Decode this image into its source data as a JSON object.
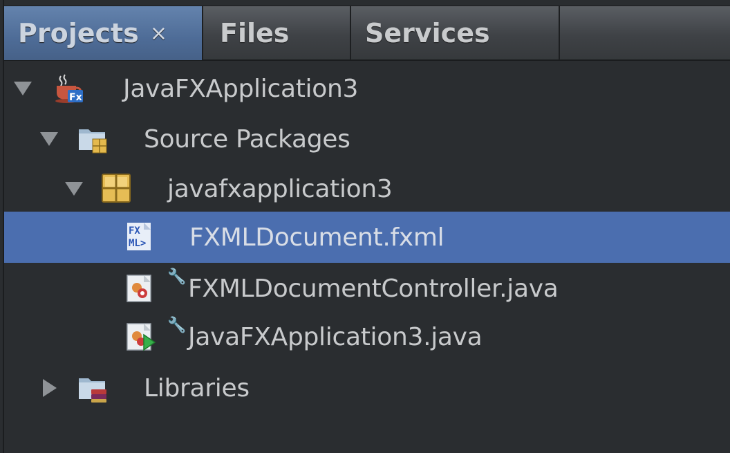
{
  "tabs": [
    {
      "label": "Projects",
      "active": true,
      "close": "×"
    },
    {
      "label": "Files",
      "active": false
    },
    {
      "label": "Services",
      "active": false
    }
  ],
  "tree": {
    "project": {
      "label": "JavaFXApplication3",
      "icon": "javafx-project-icon",
      "expanded": true
    },
    "source_packages": {
      "label": "Source Packages",
      "icon": "source-packages-icon",
      "expanded": true
    },
    "package": {
      "label": "javafxapplication3",
      "icon": "package-icon",
      "expanded": true
    },
    "files": [
      {
        "label": "FXMLDocument.fxml",
        "icon": "fxml-file-icon",
        "selected": true
      },
      {
        "label": "FXMLDocumentController.java",
        "icon": "java-class-icon",
        "selected": false
      },
      {
        "label": "JavaFXApplication3.java",
        "icon": "java-main-class-icon",
        "selected": false
      }
    ],
    "libraries": {
      "label": "Libraries",
      "icon": "libraries-icon",
      "expanded": false
    }
  },
  "colors": {
    "background": "#2a2d30",
    "selection": "#4b6eaf",
    "active_tab": "#4e6c97",
    "text": "#c8cacc"
  }
}
